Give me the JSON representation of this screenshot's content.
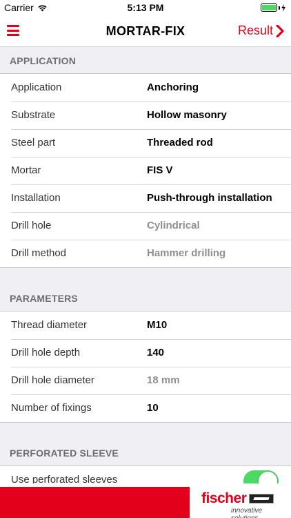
{
  "status_bar": {
    "carrier": "Carrier",
    "time": "5:13 PM",
    "wifi_icon": "wifi-icon",
    "battery_icon": "battery-icon"
  },
  "nav": {
    "title": "MORTAR-FIX",
    "menu_icon": "hamburger-menu-icon",
    "result_label": "Result",
    "result_icon": "chevron-right-icon",
    "accent_color": "#e2001a"
  },
  "application": {
    "header": "APPLICATION",
    "rows": [
      {
        "label": "Application",
        "value": "Anchoring",
        "muted": false
      },
      {
        "label": "Substrate",
        "value": "Hollow masonry",
        "muted": false
      },
      {
        "label": "Steel part",
        "value": "Threaded rod",
        "muted": false
      },
      {
        "label": "Mortar",
        "value": "FIS V",
        "muted": false
      },
      {
        "label": "Installation",
        "value": "Push-through installation",
        "muted": false
      },
      {
        "label": "Drill hole",
        "value": "Cylindrical",
        "muted": true
      },
      {
        "label": "Drill method",
        "value": "Hammer drilling",
        "muted": true
      }
    ]
  },
  "parameters": {
    "header": "PARAMETERS",
    "rows": [
      {
        "label": "Thread diameter",
        "value": "M10",
        "muted": false
      },
      {
        "label": "Drill hole depth",
        "value": "140",
        "muted": false
      },
      {
        "label": "Drill hole diameter",
        "value": "18 mm",
        "muted": true
      },
      {
        "label": "Number of fixings",
        "value": "10",
        "muted": false
      }
    ]
  },
  "perforated_sleeve": {
    "header": "PERFORATED SLEEVE",
    "toggle_label": "Use perforated sleeves",
    "toggle_on": true
  },
  "footer": {
    "brand": "fischer",
    "slogan": "innovative solutions"
  }
}
